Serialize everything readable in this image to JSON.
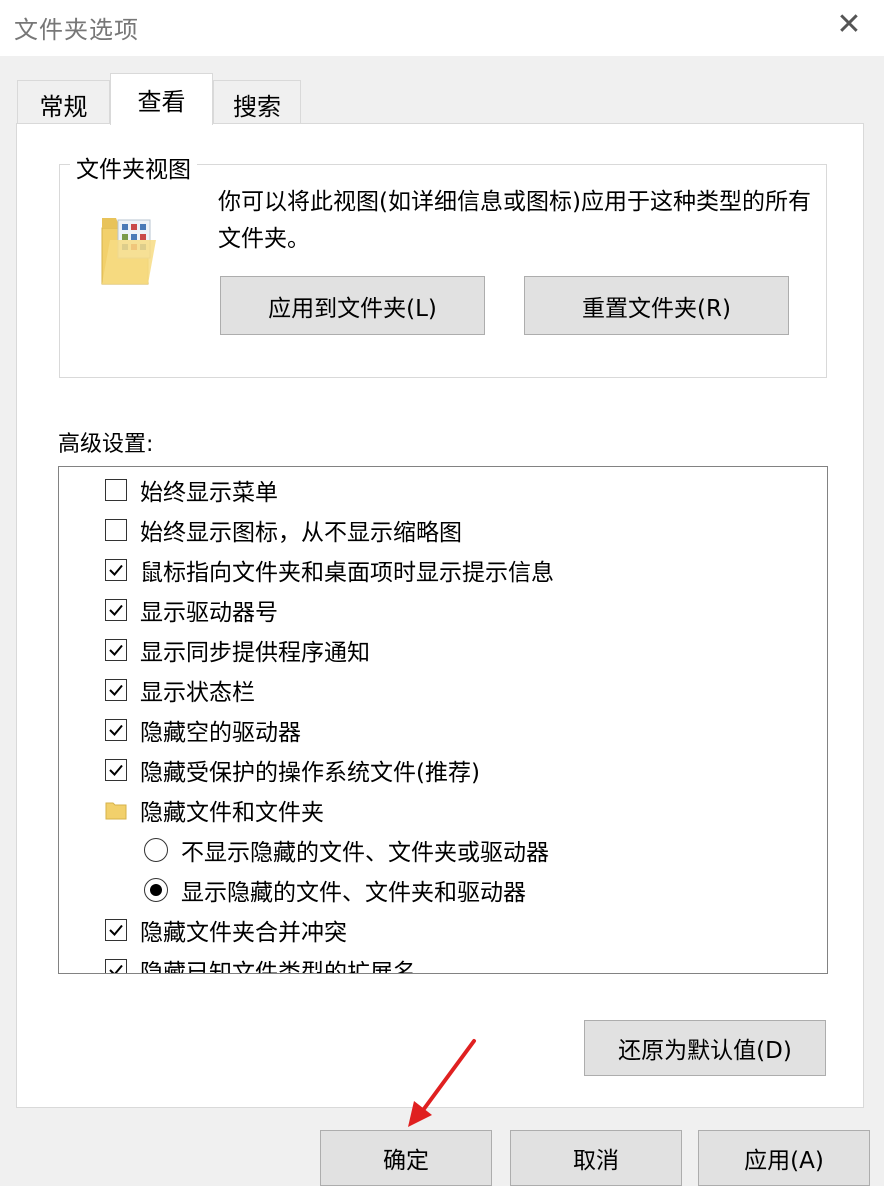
{
  "window": {
    "title": "文件夹选项",
    "close_icon": "close-icon"
  },
  "tabs": [
    {
      "label": "常规",
      "active": false
    },
    {
      "label": "查看",
      "active": true
    },
    {
      "label": "搜索",
      "active": false
    }
  ],
  "folder_views": {
    "legend": "文件夹视图",
    "description": "你可以将此视图(如详细信息或图标)应用于这种类型的所有文件夹。",
    "apply_label": "应用到文件夹(L)",
    "reset_label": "重置文件夹(R)"
  },
  "advanced": {
    "label": "高级设置:",
    "items": [
      {
        "type": "checkbox",
        "checked": false,
        "label": "始终显示菜单"
      },
      {
        "type": "checkbox",
        "checked": false,
        "label": "始终显示图标，从不显示缩略图"
      },
      {
        "type": "checkbox",
        "checked": true,
        "label": "鼠标指向文件夹和桌面项时显示提示信息"
      },
      {
        "type": "checkbox",
        "checked": true,
        "label": "显示驱动器号"
      },
      {
        "type": "checkbox",
        "checked": true,
        "label": "显示同步提供程序通知"
      },
      {
        "type": "checkbox",
        "checked": true,
        "label": "显示状态栏"
      },
      {
        "type": "checkbox",
        "checked": true,
        "label": "隐藏空的驱动器"
      },
      {
        "type": "checkbox",
        "checked": true,
        "label": "隐藏受保护的操作系统文件(推荐)"
      },
      {
        "type": "folder",
        "label": "隐藏文件和文件夹"
      },
      {
        "type": "radio",
        "checked": false,
        "label": "不显示隐藏的文件、文件夹或驱动器"
      },
      {
        "type": "radio",
        "checked": true,
        "label": "显示隐藏的文件、文件夹和驱动器"
      },
      {
        "type": "checkbox",
        "checked": true,
        "label": "隐藏文件夹合并冲突"
      },
      {
        "type": "checkbox",
        "checked": true,
        "label": "隐藏已知文件类型的扩展名"
      }
    ],
    "restore_defaults_label": "还原为默认值(D)"
  },
  "footer": {
    "ok_label": "确定",
    "cancel_label": "取消",
    "apply_label": "应用(A)"
  },
  "colors": {
    "window_bg": "#f0f0f0",
    "panel_bg": "#ffffff",
    "button_bg": "#e1e1e1",
    "annotation_arrow": "#e02020"
  }
}
